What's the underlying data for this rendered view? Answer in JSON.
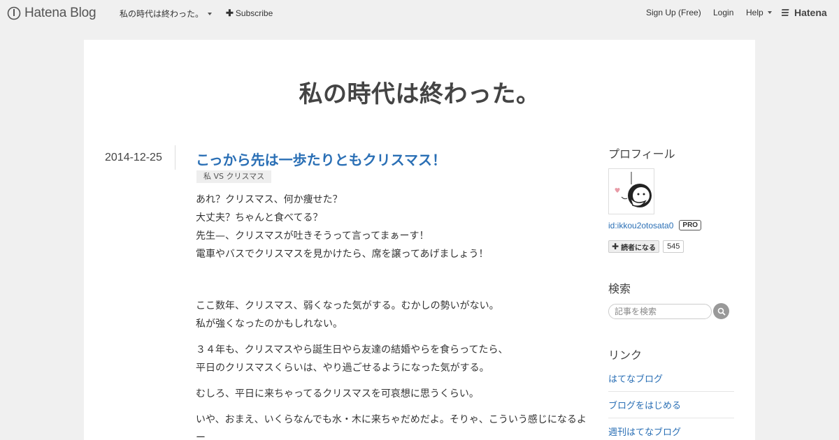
{
  "globalbar": {
    "logo_text": "Hatena Blog",
    "blog_name": "私の時代は終わった。",
    "subscribe_label": "Subscribe",
    "signup_label": "Sign Up (Free)",
    "login_label": "Login",
    "help_label": "Help",
    "hatena_label": "Hatena"
  },
  "blog": {
    "title": "私の時代は終わった。"
  },
  "entry": {
    "date": "2014-12-25",
    "title": "こっから先は一歩たりともクリスマス！",
    "category": "私 VS クリスマス",
    "paragraphs": [
      [
        "あれ？クリスマス、何か痩せた？",
        "大丈夫？ちゃんと食べてる？",
        "先生—、クリスマスが吐きそうって言ってまぁーす！",
        "電車やバスでクリスマスを見かけたら、席を譲ってあげましょう！"
      ],
      [
        "ここ数年、クリスマス、弱くなった気がする。むかしの勢いがない。",
        "私が強くなったのかもしれない。"
      ],
      [
        "３４年も、クリスマスやら誕生日やら友達の結婚やらを食らってたら、",
        "平日のクリスマスくらいは、やり過ごせるようになった気がする。"
      ],
      [
        "むしろ、平日に来ちゃってるクリスマスを可哀想に思うくらい。"
      ],
      [
        "いや、おまえ、いくらなんでも水・木に来ちゃだめだよ。そりゃ、こういう感じになるよ",
        "ー"
      ]
    ]
  },
  "sidebar": {
    "profile_title": "プロフィール",
    "profile_id": "id:ikkou2otosata0",
    "pro_badge": "PRO",
    "follow_label": "読者になる",
    "follow_count": "545",
    "search_title": "検索",
    "search_placeholder": "記事を検索",
    "links_title": "リンク",
    "links": [
      "はてなブログ",
      "ブログをはじめる",
      "週刊はてなブログ"
    ]
  },
  "colors": {
    "link": "#2a6fb5",
    "background": "#f0f0f0"
  },
  "icons": [
    "hatena-blog-logo-icon",
    "chevron-down-icon",
    "plus-icon",
    "hatena-logo-icon",
    "search-icon"
  ]
}
